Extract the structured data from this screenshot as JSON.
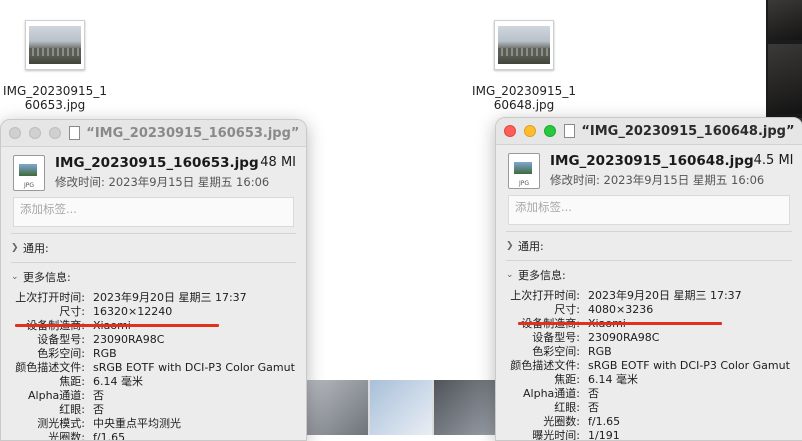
{
  "desktop": {
    "files": [
      {
        "name": "IMG_20230915_1\n60653.jpg"
      },
      {
        "name": "IMG_20230915_1\n60648.jpg"
      }
    ]
  },
  "windows": [
    {
      "title": "“IMG_20230915_160653.jpg”...",
      "filename": "IMG_20230915_160653.jpg",
      "size": "48 MI",
      "modified": "修改时间: 2023年9月15日 星期五 16:06",
      "tags_placeholder": "添加标签...",
      "section_general": "通用:",
      "section_more": "更多信息:",
      "rows": [
        {
          "k": "上次打开时间:",
          "v": "2023年9月20日 星期三 17:37"
        },
        {
          "k": "尺寸:",
          "v": "16320×12240"
        },
        {
          "k": "设备制造商:",
          "v": "Xiaomi"
        },
        {
          "k": "设备型号:",
          "v": "23090RA98C"
        },
        {
          "k": "色彩空间:",
          "v": "RGB"
        },
        {
          "k": "颜色描述文件:",
          "v": "sRGB EOTF with DCI-P3 Color Gamut"
        },
        {
          "k": "焦距:",
          "v": "6.14 毫米"
        },
        {
          "k": "Alpha通道:",
          "v": "否"
        },
        {
          "k": "红眼:",
          "v": "否"
        },
        {
          "k": "测光模式:",
          "v": "中央重点平均测光"
        },
        {
          "k": "光圈数:",
          "v": "f/1.65"
        }
      ]
    },
    {
      "title": "“IMG_20230915_160648.jpg”...",
      "filename": "IMG_20230915_160648.jpg",
      "size": "4.5 MI",
      "modified": "修改时间: 2023年9月15日 星期五 16:06",
      "tags_placeholder": "添加标签...",
      "section_general": "通用:",
      "section_more": "更多信息:",
      "rows": [
        {
          "k": "上次打开时间:",
          "v": "2023年9月20日 星期三 17:37"
        },
        {
          "k": "尺寸:",
          "v": "4080×3236"
        },
        {
          "k": "设备制造商:",
          "v": "Xiaomi"
        },
        {
          "k": "设备型号:",
          "v": "23090RA98C"
        },
        {
          "k": "色彩空间:",
          "v": "RGB"
        },
        {
          "k": "颜色描述文件:",
          "v": "sRGB EOTF with DCI-P3 Color Gamut"
        },
        {
          "k": "焦距:",
          "v": "6.14 毫米"
        },
        {
          "k": "Alpha通道:",
          "v": "否"
        },
        {
          "k": "红眼:",
          "v": "否"
        },
        {
          "k": "光圈数:",
          "v": "f/1.65"
        },
        {
          "k": "曝光时间:",
          "v": "1/191"
        }
      ]
    }
  ],
  "colors": {
    "annotation_line": "#e0311f",
    "close": "#ff5f57",
    "minimize": "#febc2e",
    "maximize": "#28c840"
  },
  "icons": {
    "file_thumbnail": "image-thumbnail-icon",
    "jpg_document": "jpg-file-icon",
    "disclosure": "chevron-right-icon",
    "disclosure_open": "chevron-down-icon"
  }
}
